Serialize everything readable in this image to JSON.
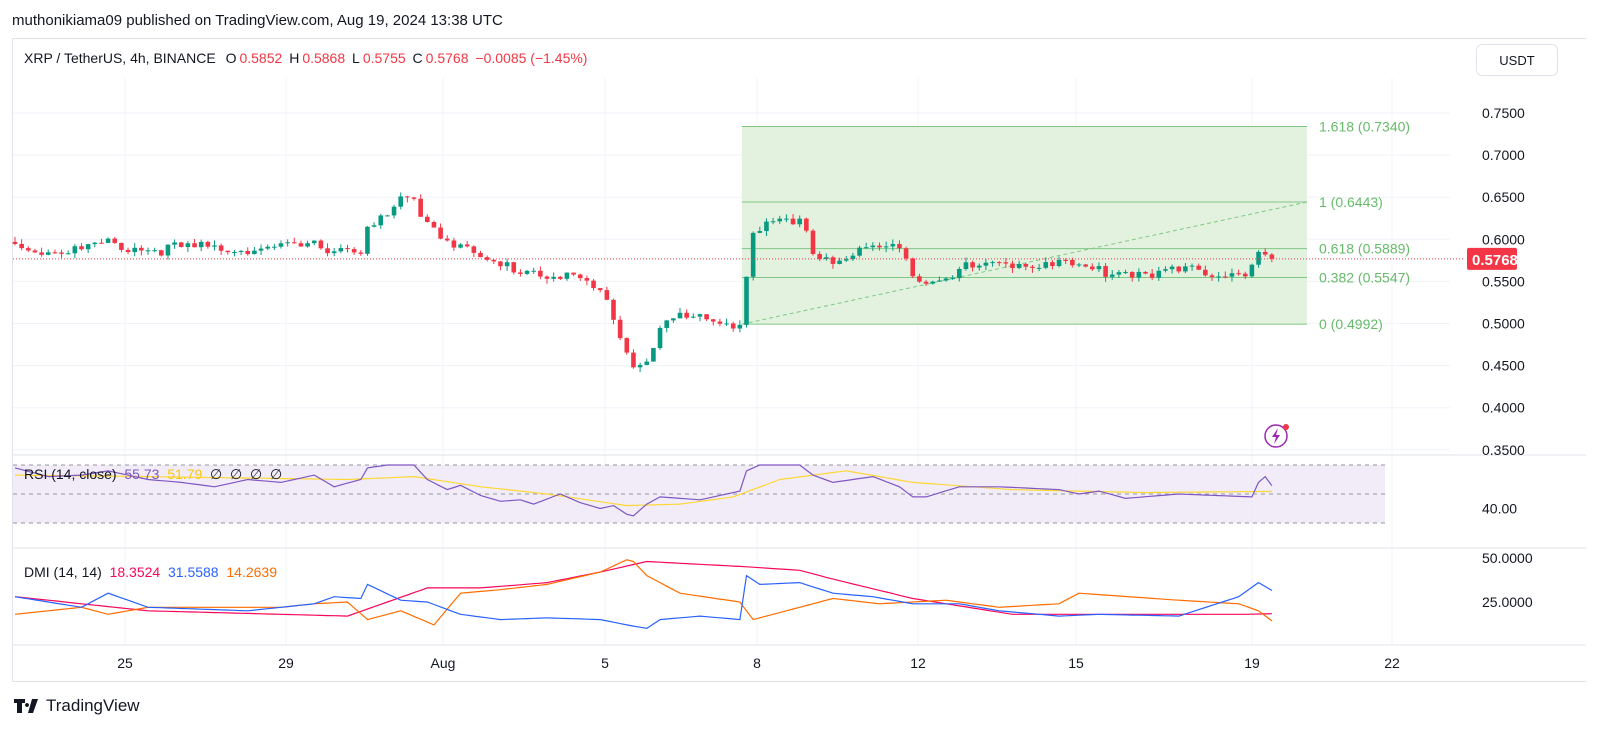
{
  "publisher": "muthonikiama09 published on TradingView.com, Aug 19, 2024 13:38 UTC",
  "legend": {
    "symbol": "XRP / TetherUS, 4h, BINANCE",
    "o_label": "O",
    "o": "0.5852",
    "h_label": "H",
    "h": "0.5868",
    "l_label": "L",
    "l": "0.5755",
    "c_label": "C",
    "c": "0.5768",
    "change": "−0.0085 (−1.45%)"
  },
  "currency_button": "USDT",
  "logo_text": "TradingView",
  "colors": {
    "up": "#089981",
    "down": "#f23645",
    "fib_fill": "#e3f2df",
    "fib_line": "#81c784",
    "rsi": "#7e57c2",
    "rsi_ma": "#fdd835",
    "adx": "#f7075b",
    "plus_di": "#2962ff",
    "minus_di": "#ff6d00"
  },
  "chart_data": {
    "type": "candlestick",
    "title": "XRP / TetherUS, 4h, BINANCE",
    "ylim": [
      0.35,
      0.75
    ],
    "y_ticks": [
      "0.7500",
      "0.7000",
      "0.6500",
      "0.6000",
      "0.5500",
      "0.5000",
      "0.4500",
      "0.4000",
      "0.3500"
    ],
    "x_ticks": [
      "25",
      "29",
      "Aug",
      "5",
      "8",
      "12",
      "15",
      "19",
      "22"
    ],
    "current_price": "0.5768",
    "candle_count": 190,
    "close_anchors": [
      [
        0,
        0.597
      ],
      [
        5,
        0.59
      ],
      [
        10,
        0.592
      ],
      [
        14,
        0.598
      ],
      [
        20,
        0.592
      ],
      [
        30,
        0.594
      ],
      [
        40,
        0.593
      ],
      [
        45,
        0.596
      ],
      [
        52,
        0.592
      ],
      [
        53,
        0.615
      ],
      [
        56,
        0.63
      ],
      [
        58,
        0.65
      ],
      [
        60,
        0.648
      ],
      [
        62,
        0.625
      ],
      [
        65,
        0.605
      ],
      [
        67,
        0.598
      ],
      [
        70,
        0.578
      ],
      [
        73,
        0.572
      ],
      [
        77,
        0.568
      ],
      [
        82,
        0.562
      ],
      [
        86,
        0.55
      ],
      [
        88,
        0.54
      ],
      [
        90,
        0.515
      ],
      [
        92,
        0.47
      ],
      [
        93,
        0.455
      ],
      [
        95,
        0.46
      ],
      [
        97,
        0.5
      ],
      [
        100,
        0.512
      ],
      [
        103,
        0.508
      ],
      [
        109,
        0.505
      ],
      [
        110,
        0.56
      ],
      [
        111,
        0.615
      ],
      [
        113,
        0.62
      ],
      [
        118,
        0.622
      ],
      [
        120,
        0.592
      ],
      [
        123,
        0.578
      ],
      [
        129,
        0.595
      ],
      [
        133,
        0.59
      ],
      [
        135,
        0.568
      ],
      [
        137,
        0.555
      ],
      [
        142,
        0.568
      ],
      [
        148,
        0.574
      ],
      [
        157,
        0.578
      ],
      [
        160,
        0.57
      ],
      [
        163,
        0.566
      ],
      [
        175,
        0.565
      ],
      [
        185,
        0.566
      ],
      [
        187,
        0.585
      ],
      [
        189,
        0.5768
      ]
    ],
    "fib": {
      "levels": [
        {
          "ratio": "1.618",
          "price": 0.734,
          "label": "1.618 (0.7340)"
        },
        {
          "ratio": "1",
          "price": 0.6443,
          "label": "1 (0.6443)"
        },
        {
          "ratio": "0.618",
          "price": 0.5889,
          "label": "0.618 (0.5889)"
        },
        {
          "ratio": "0.382",
          "price": 0.5547,
          "label": "0.382 (0.5547)"
        },
        {
          "ratio": "0",
          "price": 0.4992,
          "label": "0 (0.4992)"
        }
      ],
      "start_index": 109
    },
    "rsi": {
      "label": "RSI (14, close)",
      "value": "55.73",
      "ma_value": "51.79",
      "extras": [
        "∅",
        "∅",
        "∅",
        "∅"
      ],
      "tick": "40.00",
      "bands": [
        70,
        50,
        30
      ],
      "rsi_anchors": [
        [
          0,
          68
        ],
        [
          5,
          62
        ],
        [
          10,
          63
        ],
        [
          14,
          66
        ],
        [
          20,
          60
        ],
        [
          25,
          58
        ],
        [
          30,
          55
        ],
        [
          35,
          60
        ],
        [
          40,
          58
        ],
        [
          45,
          63
        ],
        [
          48,
          55
        ],
        [
          52,
          60
        ],
        [
          53,
          68
        ],
        [
          56,
          70
        ],
        [
          60,
          70
        ],
        [
          62,
          60
        ],
        [
          65,
          53
        ],
        [
          67,
          56
        ],
        [
          70,
          49
        ],
        [
          73,
          45
        ],
        [
          76,
          46
        ],
        [
          78,
          43
        ],
        [
          82,
          50
        ],
        [
          85,
          44
        ],
        [
          88,
          40
        ],
        [
          90,
          42
        ],
        [
          92,
          36
        ],
        [
          93,
          35
        ],
        [
          95,
          43
        ],
        [
          97,
          48
        ],
        [
          103,
          46
        ],
        [
          109,
          52
        ],
        [
          110,
          66
        ],
        [
          112,
          70
        ],
        [
          118,
          70
        ],
        [
          120,
          63
        ],
        [
          123,
          58
        ],
        [
          129,
          62
        ],
        [
          133,
          55
        ],
        [
          135,
          48
        ],
        [
          137,
          48
        ],
        [
          142,
          55
        ],
        [
          148,
          55
        ],
        [
          157,
          53
        ],
        [
          160,
          50
        ],
        [
          163,
          52
        ],
        [
          167,
          47
        ],
        [
          175,
          50
        ],
        [
          186,
          48
        ],
        [
          187,
          58
        ],
        [
          188,
          62
        ],
        [
          189,
          55.73
        ]
      ],
      "ma_anchors": [
        [
          0,
          63
        ],
        [
          20,
          62
        ],
        [
          50,
          60
        ],
        [
          60,
          62
        ],
        [
          70,
          55
        ],
        [
          80,
          50
        ],
        [
          92,
          42
        ],
        [
          100,
          43
        ],
        [
          108,
          48
        ],
        [
          115,
          60
        ],
        [
          125,
          66
        ],
        [
          135,
          58
        ],
        [
          150,
          53
        ],
        [
          170,
          51
        ],
        [
          189,
          51.79
        ]
      ]
    },
    "dmi": {
      "label": "DMI (14, 14)",
      "adx": "18.3524",
      "plus_di": "31.5588",
      "minus_di": "14.2639",
      "ticks": [
        "50.0000",
        "25.0000"
      ],
      "plus_anchors": [
        [
          0,
          28
        ],
        [
          10,
          22
        ],
        [
          14,
          30
        ],
        [
          20,
          22
        ],
        [
          35,
          20
        ],
        [
          45,
          24
        ],
        [
          48,
          28
        ],
        [
          52,
          27
        ],
        [
          53,
          35
        ],
        [
          58,
          26
        ],
        [
          62,
          25
        ],
        [
          67,
          18
        ],
        [
          73,
          15
        ],
        [
          80,
          16
        ],
        [
          88,
          15
        ],
        [
          92,
          12
        ],
        [
          95,
          10
        ],
        [
          97,
          15
        ],
        [
          103,
          17
        ],
        [
          109,
          15
        ],
        [
          110,
          40
        ],
        [
          112,
          35
        ],
        [
          118,
          36
        ],
        [
          123,
          30
        ],
        [
          129,
          28
        ],
        [
          135,
          24
        ],
        [
          142,
          24
        ],
        [
          148,
          20
        ],
        [
          157,
          17
        ],
        [
          163,
          18
        ],
        [
          175,
          17
        ],
        [
          184,
          28
        ],
        [
          187,
          36
        ],
        [
          189,
          31.56
        ]
      ],
      "minus_anchors": [
        [
          0,
          18
        ],
        [
          10,
          22
        ],
        [
          14,
          18
        ],
        [
          20,
          22
        ],
        [
          40,
          22
        ],
        [
          45,
          24
        ],
        [
          50,
          25
        ],
        [
          53,
          15
        ],
        [
          58,
          20
        ],
        [
          63,
          12
        ],
        [
          67,
          30
        ],
        [
          73,
          32
        ],
        [
          80,
          35
        ],
        [
          88,
          42
        ],
        [
          92,
          49
        ],
        [
          93,
          48
        ],
        [
          95,
          40
        ],
        [
          100,
          30
        ],
        [
          109,
          25
        ],
        [
          111,
          15
        ],
        [
          118,
          22
        ],
        [
          123,
          27
        ],
        [
          130,
          24
        ],
        [
          140,
          26
        ],
        [
          148,
          22
        ],
        [
          157,
          24
        ],
        [
          160,
          30
        ],
        [
          175,
          26
        ],
        [
          184,
          24
        ],
        [
          187,
          20
        ],
        [
          189,
          14.26
        ]
      ],
      "adx_anchors": [
        [
          0,
          28
        ],
        [
          10,
          24
        ],
        [
          20,
          20
        ],
        [
          40,
          18
        ],
        [
          50,
          17
        ],
        [
          56,
          25
        ],
        [
          62,
          33
        ],
        [
          70,
          33
        ],
        [
          80,
          36
        ],
        [
          88,
          42
        ],
        [
          95,
          48
        ],
        [
          100,
          47
        ],
        [
          110,
          45
        ],
        [
          118,
          43
        ],
        [
          123,
          38
        ],
        [
          135,
          27
        ],
        [
          150,
          18
        ],
        [
          170,
          18
        ],
        [
          185,
          18
        ],
        [
          189,
          18.35
        ]
      ]
    }
  }
}
